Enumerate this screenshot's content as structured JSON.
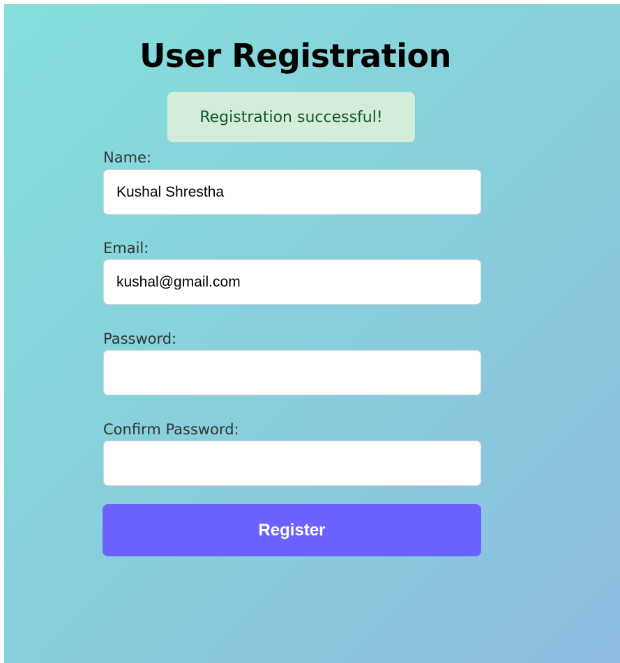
{
  "page": {
    "title": "User Registration"
  },
  "alert": {
    "message": "Registration successful!",
    "background": "#d4edda",
    "text_color": "#155724"
  },
  "form": {
    "name": {
      "label": "Name:",
      "value": "Kushal Shrestha"
    },
    "email": {
      "label": "Email:",
      "value": "kushal@gmail.com"
    },
    "password": {
      "label": "Password:",
      "value": ""
    },
    "confirm_password": {
      "label": "Confirm Password:",
      "value": ""
    },
    "submit_label": "Register",
    "submit_color": "#6c63ff"
  },
  "colors": {
    "background_gradient_start": "#84dfdb",
    "background_gradient_end": "#8fbde1"
  }
}
